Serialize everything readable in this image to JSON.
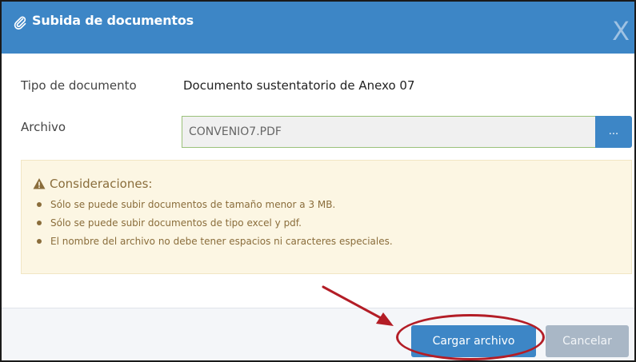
{
  "dialog": {
    "title": "Subida de documentos",
    "close_label": "X",
    "title_icon": "paperclip-icon"
  },
  "form": {
    "doc_type_label": "Tipo de documento",
    "doc_type_value": "Documento sustentatorio de Anexo 07",
    "file_label": "Archivo",
    "file_value": "CONVENIO7.PDF",
    "browse_label": "..."
  },
  "notice": {
    "icon": "warning-icon",
    "title": "Consideraciones:",
    "items": [
      "Sólo se puede subir documentos de tamaño menor a 3 MB.",
      "Sólo se puede subir documentos de tipo excel y pdf.",
      "El nombre del archivo no debe tener espacios ni caracteres especiales."
    ]
  },
  "footer": {
    "upload_label": "Cargar archivo",
    "cancel_label": "Cancelar"
  },
  "colors": {
    "primary": "#3d86c6",
    "warning_bg": "#fcf6e3",
    "warning_text": "#8a6d3b",
    "annotation": "#b31d26"
  }
}
